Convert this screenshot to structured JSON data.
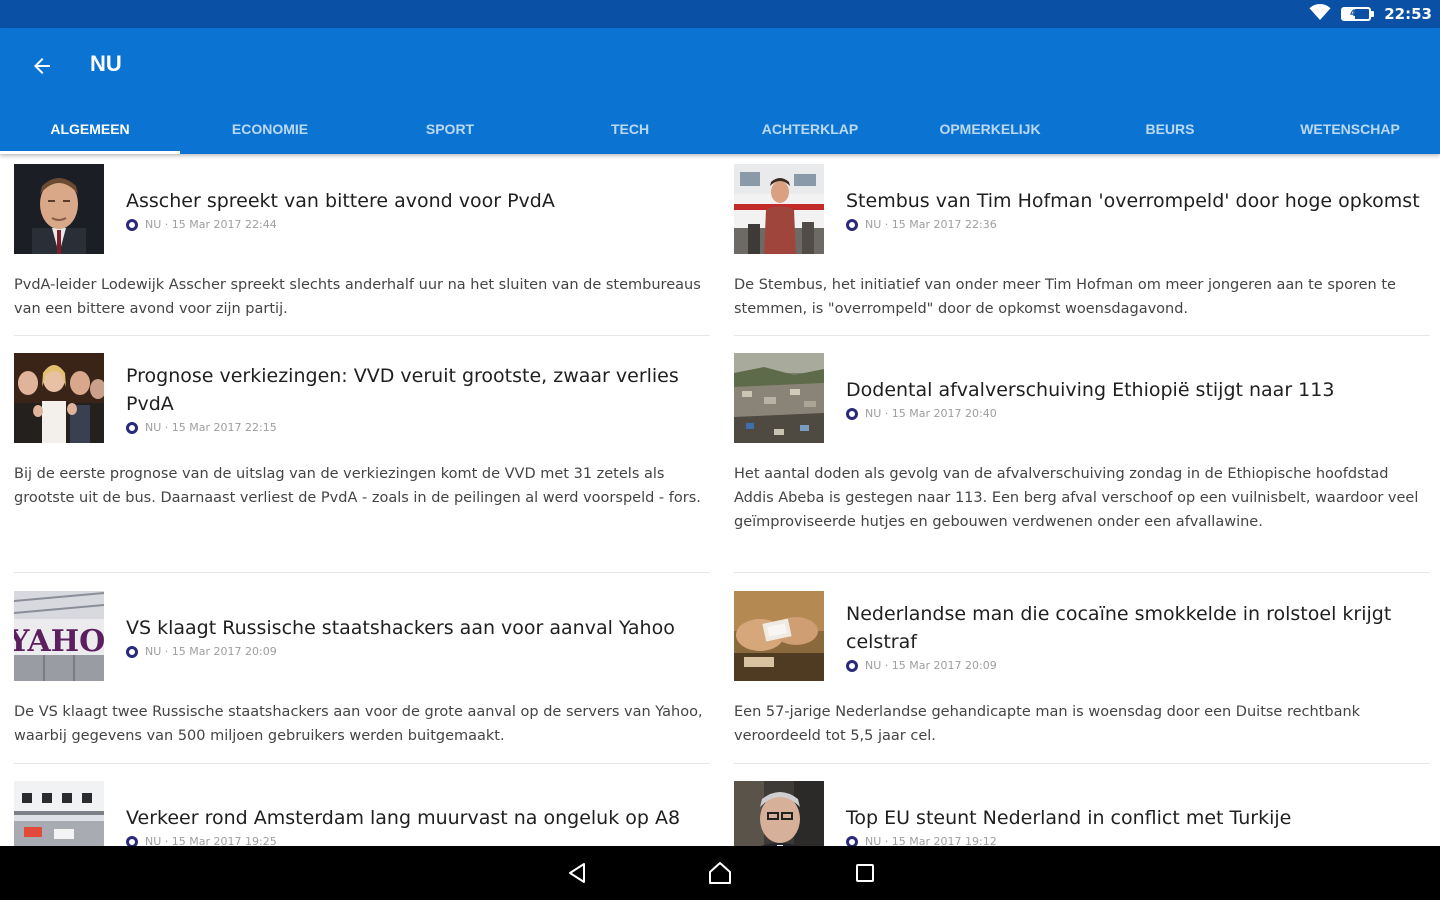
{
  "status_bar": {
    "battery_percent": "45",
    "battery_level": 0.45,
    "time": "22:53"
  },
  "app_bar": {
    "title": "NU",
    "back_icon": "arrow-left-icon"
  },
  "colors": {
    "status_bar": "#0a51a6",
    "app_bar": "#0b74d2",
    "tab_indicator": "#ffffff",
    "source_logo": "#2a2a7c"
  },
  "tabs": [
    {
      "label": "ALGEMEEN",
      "active": true
    },
    {
      "label": "ECONOMIE",
      "active": false
    },
    {
      "label": "SPORT",
      "active": false
    },
    {
      "label": "TECH",
      "active": false
    },
    {
      "label": "ACHTERKLAP",
      "active": false
    },
    {
      "label": "OPMERKELIJK",
      "active": false
    },
    {
      "label": "BEURS",
      "active": false
    },
    {
      "label": "WETENSCHAP",
      "active": false
    }
  ],
  "articles": [
    {
      "title": "Asscher spreekt van bittere avond voor PvdA",
      "source": "NU",
      "date": "15 Mar 2017 22:44",
      "excerpt": "PvdA-leider Lodewijk Asscher spreekt slechts anderhalf uur na het sluiten van de stembureaus van een bittere avond voor zijn partij."
    },
    {
      "title": "Stembus van Tim Hofman 'overrompeld' door hoge opkomst",
      "source": "NU",
      "date": "15 Mar 2017 22:36",
      "excerpt": "De Stembus, het initiatief van onder meer Tim Hofman om meer jongeren aan te sporen te stemmen, is \"overrompeld\" door de opkomst woensdagavond."
    },
    {
      "title": "Prognose verkiezingen: VVD veruit grootste, zwaar verlies PvdA",
      "source": "NU",
      "date": "15 Mar 2017 22:15",
      "excerpt": "Bij de eerste prognose van de uitslag van de verkiezingen komt de VVD met 31 zetels als grootste uit de bus. Daarnaast verliest de PvdA - zoals in de peilingen al werd voorspeld - fors."
    },
    {
      "title": "Dodental afvalverschuiving Ethiopië stijgt naar 113",
      "source": "NU",
      "date": "15 Mar 2017 20:40",
      "excerpt": "Het aantal doden als gevolg van de afvalverschuiving zondag in de Ethiopische hoofdstad Addis Abeba is gestegen naar 113. Een berg afval verschoof op een vuilnisbelt, waardoor veel geïmproviseerde hutjes en gebouwen verdwenen onder een afvallawine."
    },
    {
      "title": "VS klaagt Russische staatshackers aan voor aanval Yahoo",
      "source": "NU",
      "date": "15 Mar 2017 20:09",
      "thumb_text": "YAHOO",
      "excerpt": "De VS klaagt twee Russische staatshackers aan voor de grote aanval op de servers van Yahoo, waarbij gegevens van 500 miljoen gebruikers werden buitgemaakt."
    },
    {
      "title": "Nederlandse man die cocaïne smokkelde in rolstoel krijgt celstraf",
      "source": "NU",
      "date": "15 Mar 2017 20:09",
      "excerpt": "Een 57-jarige Nederlandse gehandicapte man is woensdag door een Duitse rechtbank veroordeeld tot 5,5 jaar cel."
    },
    {
      "title": "Verkeer rond Amsterdam lang muurvast na ongeluk op A8",
      "source": "NU",
      "date": "15 Mar 2017 19:25",
      "excerpt": ""
    },
    {
      "title": "Top EU steunt Nederland in conflict met Turkije",
      "source": "NU",
      "date": "15 Mar 2017 19:12",
      "excerpt": ""
    }
  ],
  "nav_bar": {
    "back_icon": "nav-back-icon",
    "home_icon": "nav-home-icon",
    "recents_icon": "nav-recents-icon"
  }
}
